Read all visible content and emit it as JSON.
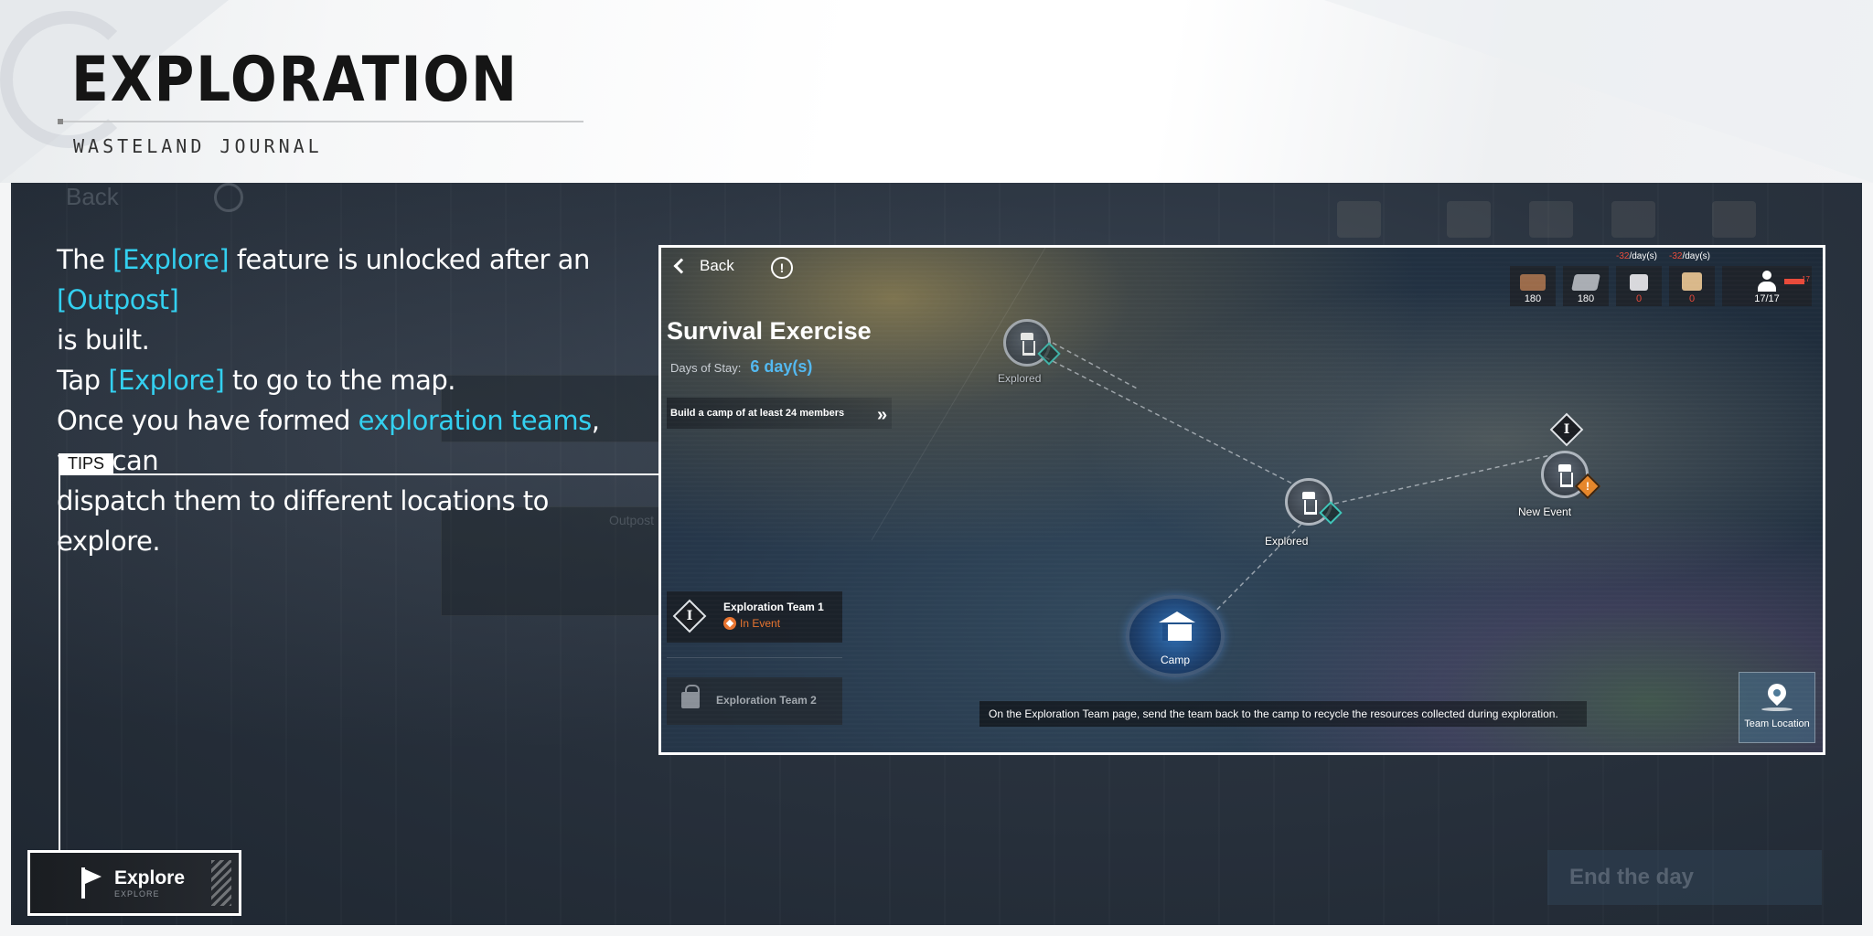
{
  "header": {
    "title": "EXPLORATION",
    "subtitle": "WASTELAND JOURNAL"
  },
  "background_ui": {
    "back_label": "Back",
    "outpost_label": "Outpost",
    "end_day_label": "End the day"
  },
  "instructions": {
    "l1_a": "The ",
    "l1_b": "[Explore]",
    "l1_c": " feature is unlocked after an ",
    "l1_d": "[Outpost]",
    "l2": "is built.",
    "l3_a": "Tap ",
    "l3_b": "[Explore]",
    "l3_c": " to go to the map.",
    "l4_a": "Once you have formed ",
    "l4_b": "exploration teams",
    "l4_c": ", you can",
    "l5": "dispatch them to different locations to explore."
  },
  "tips": {
    "label": "TIPS"
  },
  "explore_button": {
    "title": "Explore",
    "subtitle": "EXPLORE",
    "icon": "flag-icon"
  },
  "inset": {
    "back_label": "Back",
    "info_icon": "!",
    "title": "Survival Exercise",
    "days_label": "Days of Stay:",
    "days_value": "6 day(s)",
    "task": "Build a camp of at least 24 members",
    "task_arrow": "»",
    "resources": [
      {
        "icon": "wood-icon",
        "value": "180",
        "rate": "",
        "color": "#9b6b4a"
      },
      {
        "icon": "metal-icon",
        "value": "180",
        "rate": "",
        "color": "#a9adb3"
      },
      {
        "icon": "medicine-icon",
        "value": "0",
        "rate_neg": "-32",
        "rate_suffix": "/day(s)",
        "color": "#d8d8dc"
      },
      {
        "icon": "food-icon",
        "value": "0",
        "rate_neg": "-32",
        "rate_suffix": "/day(s)",
        "color": "#d9b88a"
      },
      {
        "icon": "population-icon",
        "value": "17/17",
        "beds": "17"
      }
    ],
    "nodes": {
      "node_a_label": "Explored",
      "node_b_label": "Explored",
      "node_c_label": "New Event",
      "team_numeral": "I",
      "camp_label": "Camp"
    },
    "teams": {
      "team1_name": "Exploration Team 1",
      "team1_status": "In Event",
      "team1_numeral": "I",
      "team2_name": "Exploration Team 2"
    },
    "hint": "On the Exploration Team page, send the team back to the camp to recycle the resources collected during exploration.",
    "team_location_label": "Team Location"
  },
  "colors": {
    "highlight": "#33d0f0",
    "days_value": "#52b8f0",
    "warning": "#e84a3a",
    "event_orange": "#e8742f"
  }
}
